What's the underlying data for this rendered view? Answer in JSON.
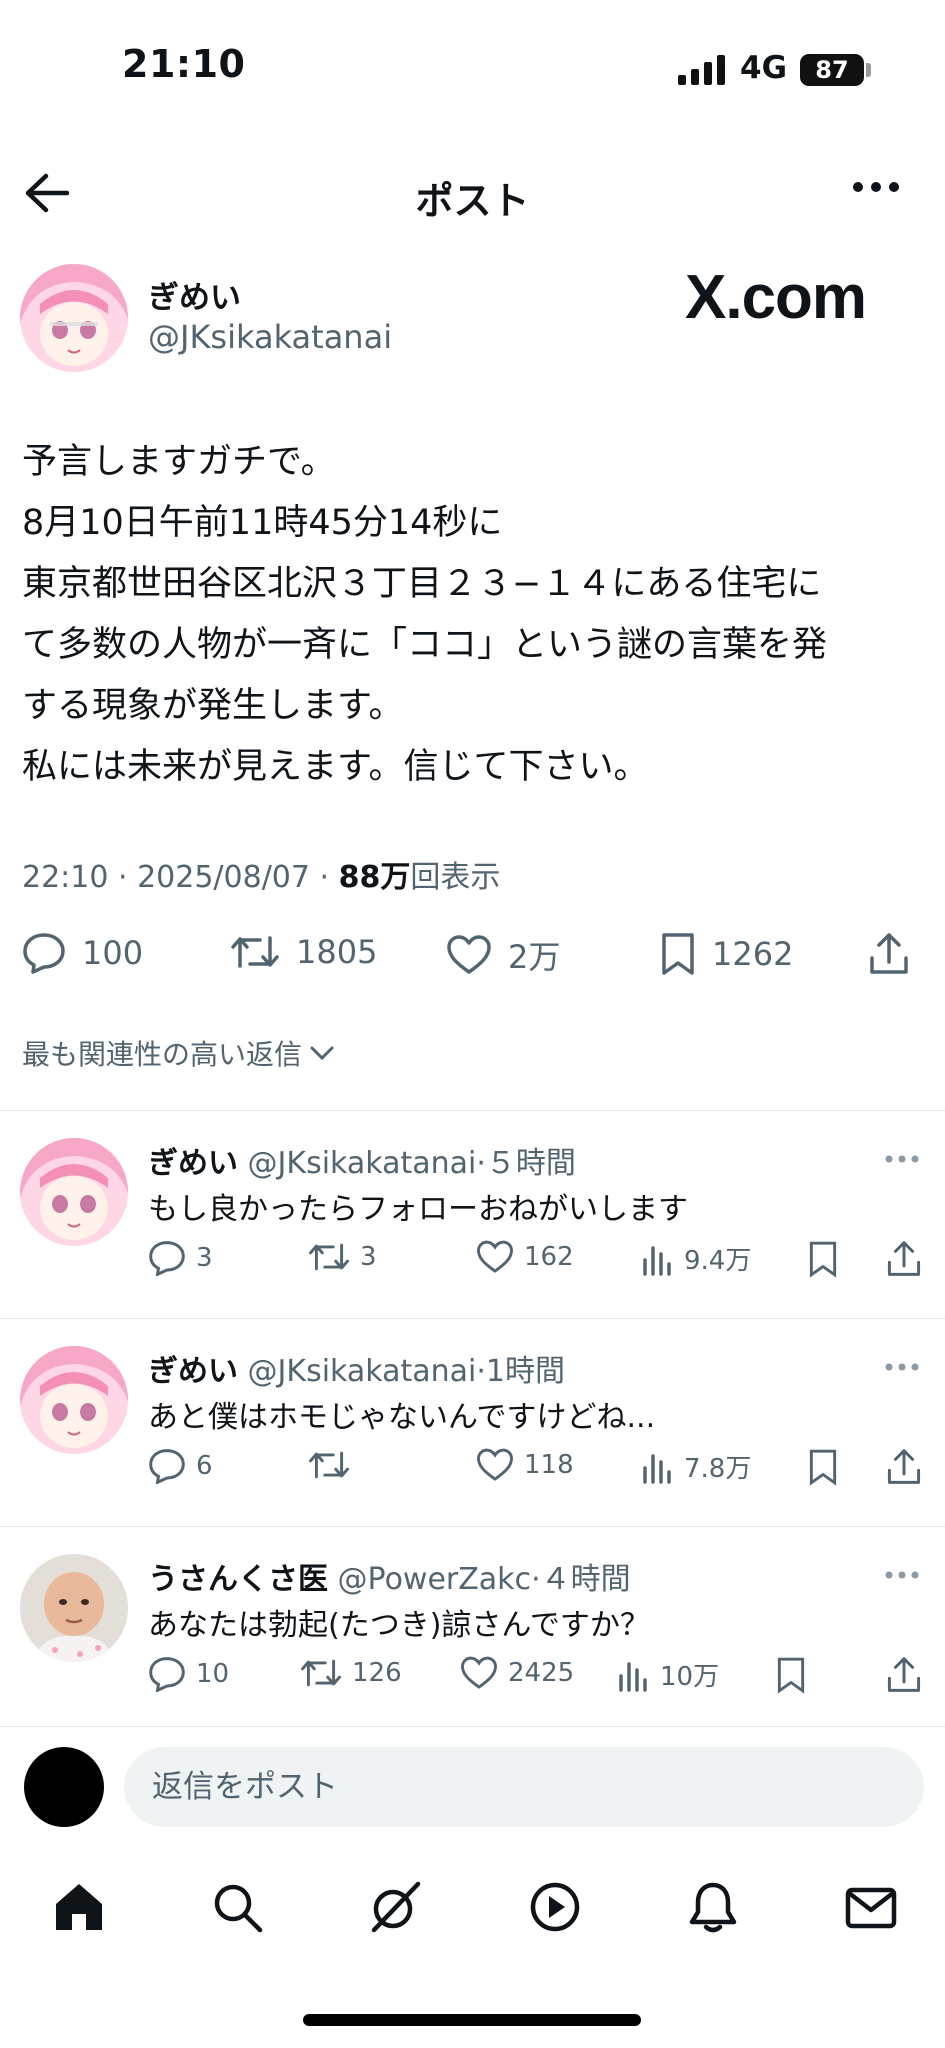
{
  "status_bar": {
    "time": "21:10",
    "network": "4G",
    "battery": "87"
  },
  "header": {
    "title": "ポスト"
  },
  "watermark": "X.com",
  "post": {
    "author_name": "ぎめい",
    "author_handle": "@JKsikakatanai",
    "lines": [
      "予言しますガチで。",
      "8月10日午前11時45分14秒に",
      "東京都世田谷区北沢３丁目２３−１４にある住宅に",
      "て多数の人物が一斉に「ココ」という謎の言葉を発",
      "する現象が発生します。",
      "私には未来が見えます。信じて下さい。"
    ],
    "timestamp": "22:10 · 2025/08/07 · ",
    "views_count": "88万",
    "views_label": "回表示",
    "replies": "100",
    "reposts": "1805",
    "likes": "2万",
    "bookmarks": "1262"
  },
  "sort_label": "最も関連性の高い返信",
  "replies": [
    {
      "name": "ぎめい",
      "handle": "@JKsikakatanai",
      "time": "·５時間",
      "text": "もし良かったらフォローおねがいします",
      "replies": "3",
      "reposts": "3",
      "likes": "162",
      "views": "9.4万"
    },
    {
      "name": "ぎめい",
      "handle": "@JKsikakatanai",
      "time": "·1時間",
      "text": "あと僕はホモじゃないんですけどね...",
      "replies": "6",
      "reposts": "",
      "likes": "118",
      "views": "7.8万"
    },
    {
      "name": "うさんくさ医",
      "handle": "@PowerZakc",
      "time": "·４時間",
      "text": "あなたは勃起(たつき)諒さんですか？",
      "replies": "10",
      "reposts": "126",
      "likes": "2425",
      "views": "10万"
    }
  ],
  "composer": {
    "placeholder": "返信をポスト"
  },
  "tabs": [
    "home-icon",
    "search-icon",
    "grok-icon",
    "video-icon",
    "notifications-icon",
    "messages-icon"
  ]
}
